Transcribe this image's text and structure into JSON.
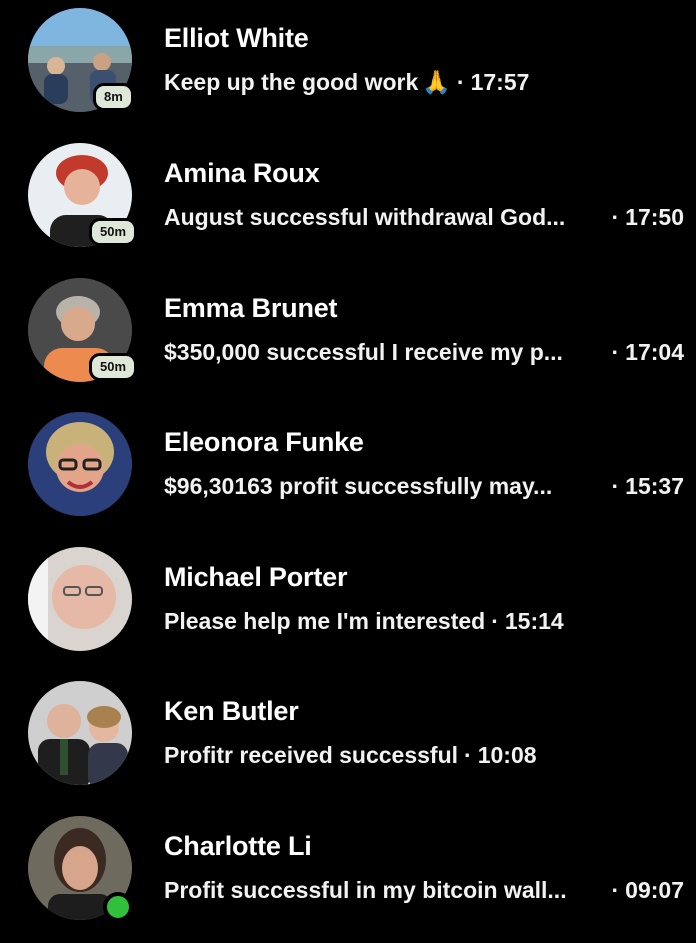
{
  "chats": [
    {
      "name": "Elliot White",
      "message": "Keep up the good work",
      "emoji": "🙏",
      "time": "17:57",
      "badge": "8m"
    },
    {
      "name": "Amina Roux",
      "message": "August successful withdrawal God...",
      "time": "17:50",
      "badge": "50m"
    },
    {
      "name": "Emma Brunet",
      "message": "$350,000 successful I receive my p...",
      "time": "17:04",
      "badge": "50m"
    },
    {
      "name": "Eleonora Funke",
      "message": "$96,30163 profit successfully may...",
      "time": "15:37"
    },
    {
      "name": "Michael Porter",
      "message": "Please help me I'm interested",
      "time": "15:14"
    },
    {
      "name": "Ken Butler",
      "message": "Profitr received successful",
      "time": "10:08"
    },
    {
      "name": "Charlotte Li",
      "message": "Profit successful in my bitcoin wall...",
      "time": "09:07",
      "online": true
    }
  ],
  "separator": "·",
  "colors": {
    "background": "#000000",
    "text": "#ffffff",
    "badge": "#dfe7d9",
    "online": "#31c03b"
  }
}
